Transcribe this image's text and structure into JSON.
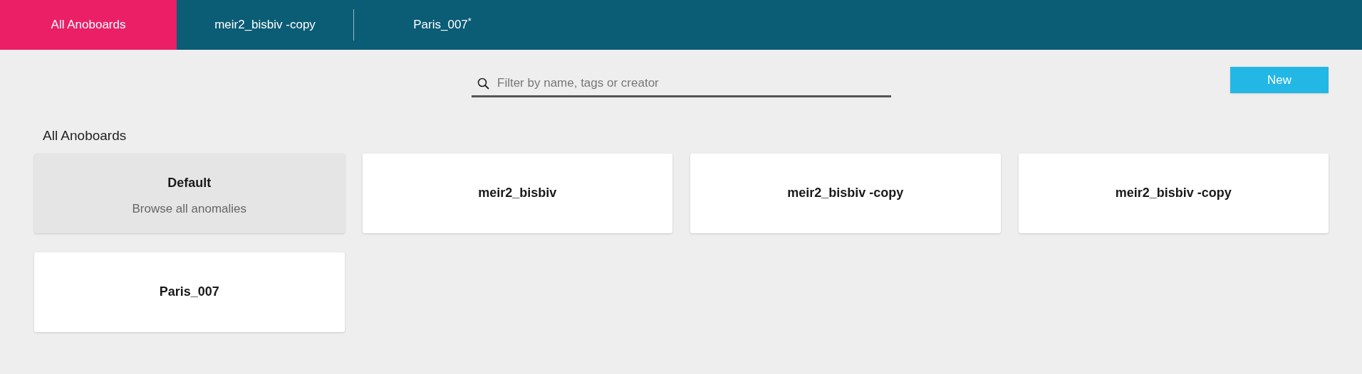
{
  "tabs": [
    {
      "label": "All Anoboards",
      "selected": true
    },
    {
      "label": "meir2_bisbiv -copy",
      "selected": false
    },
    {
      "label": "Paris_007$^{*}$",
      "selected": false
    }
  ],
  "search": {
    "placeholder": "Filter by name, tags or creator"
  },
  "new_button": "New",
  "section_title": "All Anoboards",
  "boards": [
    {
      "kind": "default",
      "title": "Default",
      "subtitle": "Browse all anomalies"
    },
    {
      "kind": "board",
      "title": "meir2_bisbiv"
    },
    {
      "kind": "board",
      "title": "meir2_bisbiv -copy"
    },
    {
      "kind": "board",
      "title": "meir2_bisbiv -copy"
    },
    {
      "kind": "board",
      "title": "Paris_007"
    }
  ]
}
